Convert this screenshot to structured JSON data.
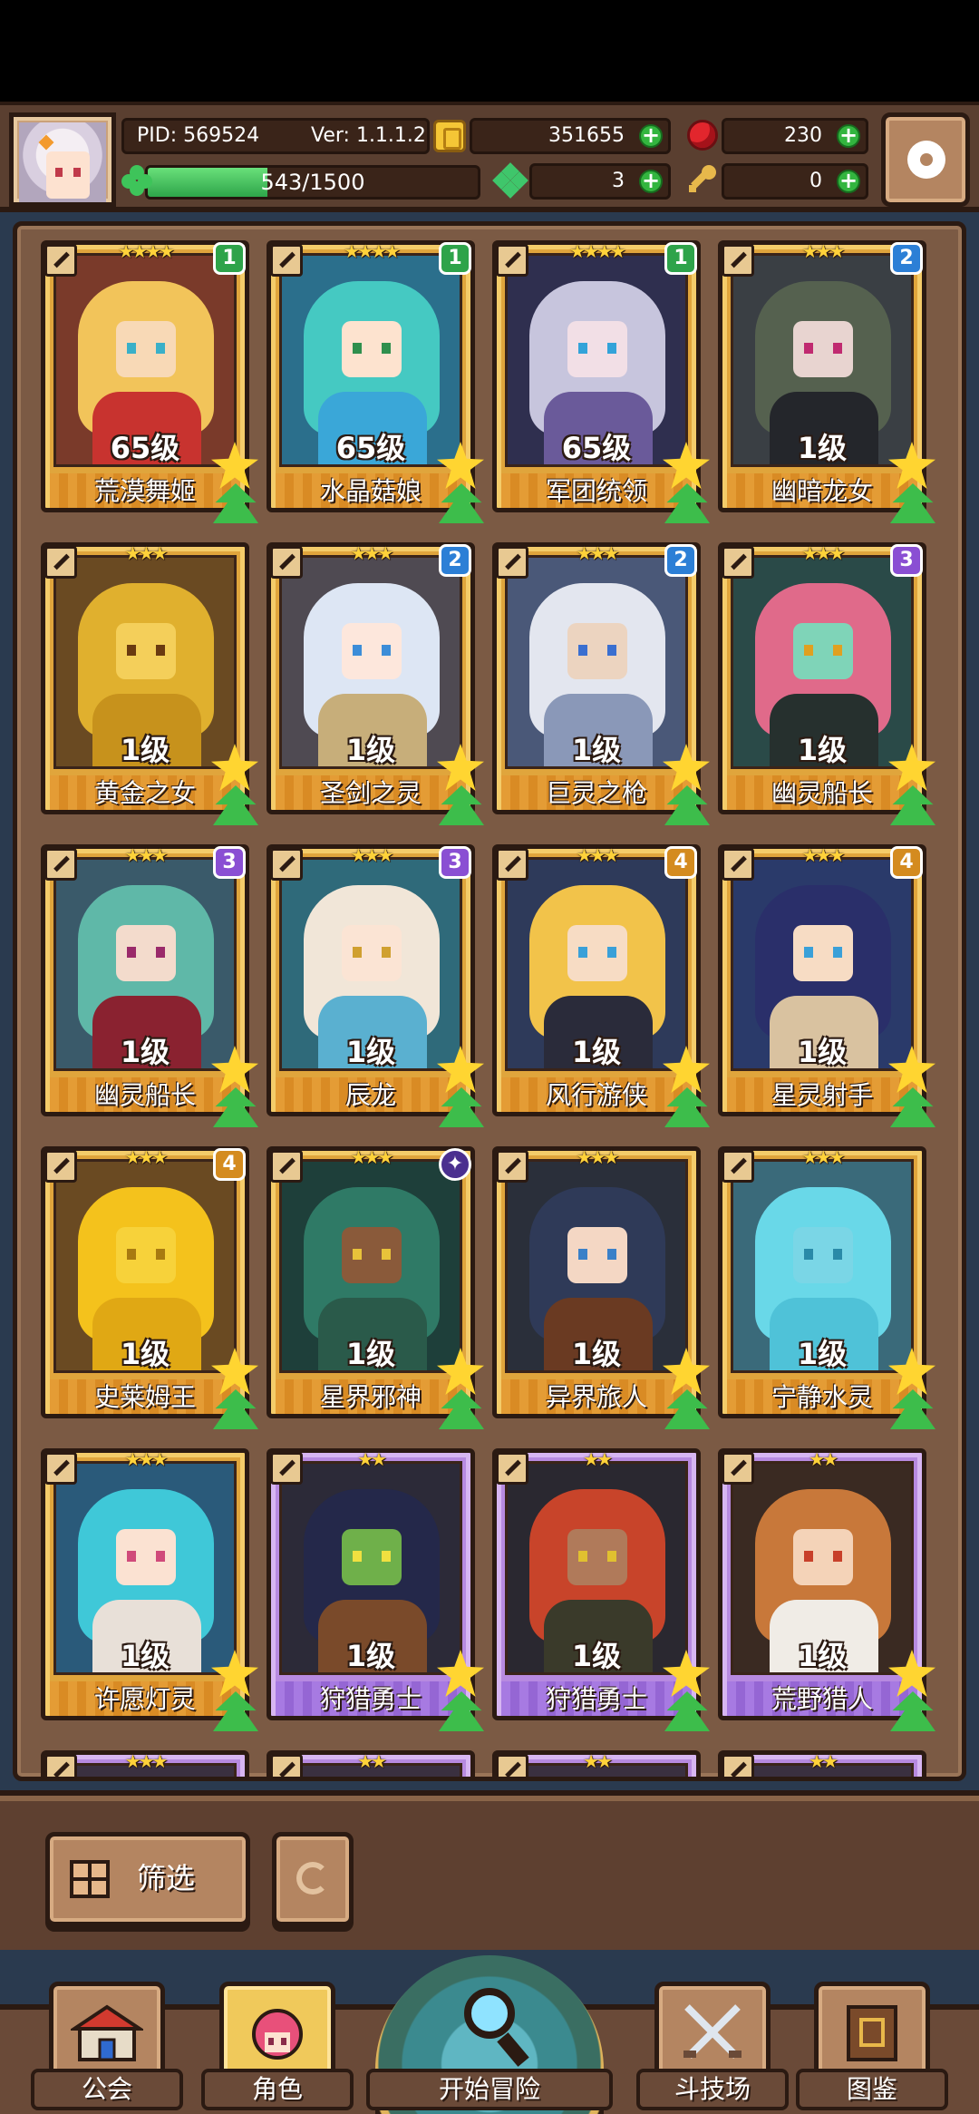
{
  "header": {
    "pid": "PID: 569524",
    "version": "Ver: 1.1.1.2",
    "gold": "351655",
    "ruby": "230",
    "energy": "543/1500",
    "energy_fraction": 0.362,
    "clover": "3",
    "key": "0"
  },
  "cards": [
    {
      "name": "荒漠舞姬",
      "level": "65级",
      "stars": "★★★★",
      "badge": "1",
      "frame": "gold",
      "palette": {
        "bg": "#7a3a2a",
        "hair": "#f2c45a",
        "skin": "#f8d9b6",
        "body": "#c8332f",
        "eye": "#3ab0c8"
      }
    },
    {
      "name": "水晶菇娘",
      "level": "65级",
      "stars": "★★★★",
      "badge": "1",
      "frame": "gold",
      "palette": {
        "bg": "#2b6f8c",
        "hair": "#45c9c2",
        "skin": "#fde3cf",
        "body": "#3aa7d8",
        "eye": "#2f8f4d"
      }
    },
    {
      "name": "军团统领",
      "level": "65级",
      "stars": "★★★★",
      "badge": "1",
      "frame": "gold",
      "palette": {
        "bg": "#2f2f4f",
        "hair": "#c7c5dd",
        "skin": "#f2dfe6",
        "body": "#6a5a9a",
        "eye": "#33a3d9"
      }
    },
    {
      "name": "幽暗龙女",
      "level": "1级",
      "stars": "★★★",
      "badge": "2",
      "frame": "gold",
      "palette": {
        "bg": "#3a3f44",
        "hair": "#55614f",
        "skin": "#e8d4d0",
        "body": "#24262b",
        "eye": "#c02a70"
      }
    },
    {
      "name": "黄金之女",
      "level": "1级",
      "stars": "★★★",
      "badge": "",
      "frame": "gold",
      "palette": {
        "bg": "#6a4a22",
        "hair": "#e0b02e",
        "skin": "#f4cf5a",
        "body": "#c7921c",
        "eye": "#6a3a10"
      }
    },
    {
      "name": "圣剑之灵",
      "level": "1级",
      "stars": "★★★",
      "badge": "2",
      "frame": "gold",
      "palette": {
        "bg": "#4f4a52",
        "hair": "#dde6f4",
        "skin": "#fde7dc",
        "body": "#c7ae7a",
        "eye": "#3c8dd8"
      }
    },
    {
      "name": "巨灵之枪",
      "level": "1级",
      "stars": "★★★",
      "badge": "2",
      "frame": "gold",
      "palette": {
        "bg": "#4a5878",
        "hair": "#e3e6ef",
        "skin": "#ecd4c0",
        "body": "#8a98b8",
        "eye": "#3a6fd0"
      }
    },
    {
      "name": "幽灵船长",
      "level": "1级",
      "stars": "★★★",
      "badge": "3",
      "frame": "gold",
      "palette": {
        "bg": "#2a4a48",
        "hair": "#e06a8a",
        "skin": "#7fd4b8",
        "body": "#26302e",
        "eye": "#e0a020"
      }
    },
    {
      "name": "幽灵船长",
      "level": "1级",
      "stars": "★★★",
      "badge": "3",
      "frame": "gold",
      "palette": {
        "bg": "#3a5a6a",
        "hair": "#5fb8a8",
        "skin": "#f3dbcc",
        "body": "#8a2230",
        "eye": "#9a2a6a"
      }
    },
    {
      "name": "辰龙",
      "level": "1级",
      "stars": "★★★",
      "badge": "3",
      "frame": "gold",
      "palette": {
        "bg": "#2f6a7a",
        "hair": "#f1e6d8",
        "skin": "#fbe4d4",
        "body": "#5ab0d0",
        "eye": "#d0a030"
      }
    },
    {
      "name": "风行游侠",
      "level": "1级",
      "stars": "★★★",
      "badge": "4",
      "frame": "gold",
      "palette": {
        "bg": "#2e3a5a",
        "hair": "#f2c34a",
        "skin": "#f7dcc4",
        "body": "#2a2b3a",
        "eye": "#3aa0d8"
      }
    },
    {
      "name": "星灵射手",
      "level": "1级",
      "stars": "★★★",
      "badge": "4",
      "frame": "gold",
      "palette": {
        "bg": "#2a3a6a",
        "hair": "#2a2f6a",
        "skin": "#f7dcc4",
        "body": "#d9c2a0",
        "eye": "#3aa0d8"
      }
    },
    {
      "name": "史莱姆王",
      "level": "1级",
      "stars": "★★★",
      "badge": "4",
      "frame": "gold",
      "palette": {
        "bg": "#6a4a22",
        "hair": "#f4c21c",
        "skin": "#f7d23a",
        "body": "#e0a814",
        "eye": "#a87a10"
      }
    },
    {
      "name": "星界邪神",
      "level": "1级",
      "stars": "★★★",
      "badge": "✦",
      "frame": "gold",
      "palette": {
        "bg": "#1e3f3a",
        "hair": "#2f7a66",
        "skin": "#8a5a3a",
        "body": "#2a5a4a",
        "eye": "#e8c23a"
      }
    },
    {
      "name": "异界旅人",
      "level": "1级",
      "stars": "★★★",
      "badge": "",
      "frame": "gold",
      "palette": {
        "bg": "#2a2f3a",
        "hair": "#2f3a58",
        "skin": "#f4d7c4",
        "body": "#6a3a22",
        "eye": "#3a80c8"
      }
    },
    {
      "name": "宁静水灵",
      "level": "1级",
      "stars": "★★★",
      "badge": "",
      "frame": "gold",
      "palette": {
        "bg": "#3a6a7a",
        "hair": "#69d8e8",
        "skin": "#7ad6e6",
        "body": "#4fc2d8",
        "eye": "#2a8aa8"
      }
    },
    {
      "name": "许愿灯灵",
      "level": "1级",
      "stars": "★★★",
      "badge": "",
      "frame": "gold",
      "palette": {
        "bg": "#2a5a7a",
        "hair": "#3fc8d8",
        "skin": "#fbe2d2",
        "body": "#e8e0d8",
        "eye": "#d04a7a"
      }
    },
    {
      "name": "狩猎勇士",
      "level": "1级",
      "stars": "★★",
      "badge": "",
      "frame": "purple",
      "palette": {
        "bg": "#2c2a38",
        "hair": "#24284a",
        "skin": "#6fb04a",
        "body": "#7a4a2a",
        "eye": "#f0e040"
      }
    },
    {
      "name": "狩猎勇士",
      "level": "1级",
      "stars": "★★",
      "badge": "",
      "frame": "purple",
      "palette": {
        "bg": "#2a2830",
        "hair": "#c8442a",
        "skin": "#b07a5a",
        "body": "#3a3a2a",
        "eye": "#e0c030"
      }
    },
    {
      "name": "荒野猎人",
      "level": "1级",
      "stars": "★★",
      "badge": "",
      "frame": "purple",
      "palette": {
        "bg": "#3a2a22",
        "hair": "#c8783a",
        "skin": "#f4d3b8",
        "body": "#f0ece6",
        "eye": "#c8402a"
      }
    },
    {
      "name": "",
      "level": "",
      "stars": "★★★",
      "badge": "",
      "frame": "purple",
      "palette": {
        "bg": "#3a3040",
        "hair": "#555",
        "skin": "#ddd",
        "body": "#444",
        "eye": "#888"
      }
    },
    {
      "name": "",
      "level": "",
      "stars": "★★",
      "badge": "",
      "frame": "purple",
      "palette": {
        "bg": "#3a3040",
        "hair": "#555",
        "skin": "#ddd",
        "body": "#444",
        "eye": "#888"
      }
    },
    {
      "name": "",
      "level": "",
      "stars": "★★",
      "badge": "",
      "frame": "purple",
      "palette": {
        "bg": "#3a3040",
        "hair": "#c8442a",
        "skin": "#ddd",
        "body": "#444",
        "eye": "#888"
      }
    },
    {
      "name": "",
      "level": "",
      "stars": "★★",
      "badge": "",
      "frame": "purple",
      "palette": {
        "bg": "#3a3040",
        "hair": "#8a5a3a",
        "skin": "#ddd",
        "body": "#444",
        "eye": "#888"
      }
    }
  ],
  "toolbar": {
    "filter_label": "筛选"
  },
  "nav": {
    "guild": "公会",
    "characters": "角色",
    "adventure": "开始冒险",
    "arena": "斗技场",
    "codex": "图鉴"
  },
  "icons": {
    "gold": "coin-icon",
    "ruby": "ruby-icon",
    "energy": "clover-icon",
    "leaf": "leaf-icon",
    "key": "key-icon",
    "settings": "gear-icon"
  }
}
